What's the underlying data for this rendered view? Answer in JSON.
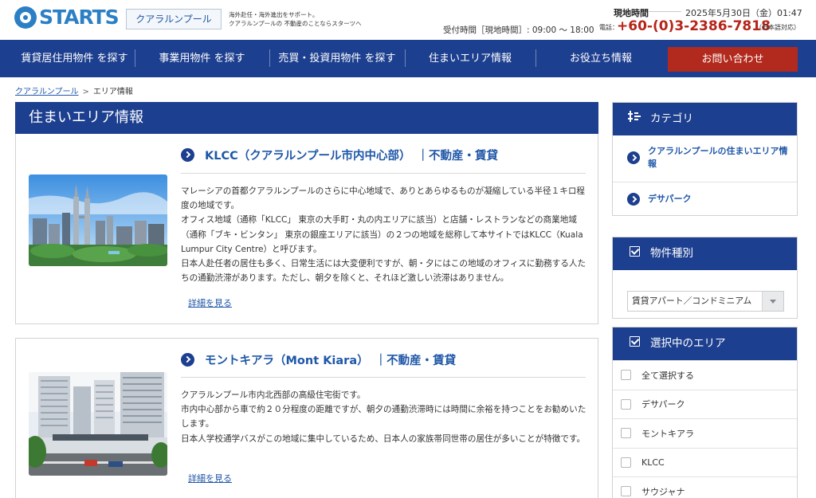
{
  "header": {
    "logo_text": "STARTS",
    "city_badge": "クアラルンプール",
    "tagline_1": "海外赴任・海外進出をサポート。",
    "tagline_2": "クアラルンプールの 不動産のことならスターツへ",
    "hours": "受付時間［現地時間］: 09:00 〜 18:00",
    "now_label": "現地時間",
    "now_value": "2025年5月30日（金）01:47",
    "phone_label": "電話：",
    "phone_number": "+60-(0)3-2386-7818",
    "phone_note": "（日本語対応）"
  },
  "nav": {
    "items": [
      "賃貸居住用物件 を探す",
      "事業用物件 を探す",
      "売買・投資用物件 を探す",
      "住まいエリア情報",
      "お役立ち情報"
    ],
    "cta": "お問い合わせ"
  },
  "breadcrumb": {
    "home": "クアラルンプール",
    "separator": ">",
    "current": "エリア情報"
  },
  "main": {
    "title": "住まいエリア情報",
    "cards": [
      {
        "title": "KLCC（クアラルンプール市内中心部）",
        "subtitle": "｜不動産・賃貸",
        "paragraphs": [
          "マレーシアの首都クアラルンプールのさらに中心地域で、ありとあらゆるものが凝縮している半径１キロ程度の地域です。",
          "オフィス地域（通称「KLCC」 東京の大手町・丸の内エリアに該当）と店舗・レストランなどの商業地域（通称「ブキ・ビンタン」 東京の銀座エリアに該当）の２つの地域を総称して本サイトではKLCC（Kuala Lumpur City Centre）と呼びます。",
          "日本人赴任者の居住も多く、日常生活には大変便利ですが、朝・夕にはこの地域のオフィスに勤務する人たちの通勤渋滞があります。ただし、朝夕を除くと、それほど激しい渋滞はありません。"
        ],
        "link": "詳細を見る"
      },
      {
        "title": "モントキアラ（Mont Kiara）",
        "subtitle": "｜不動産・賃貸",
        "paragraphs": [
          "クアラルンプール市内北西部の高級住宅街です。",
          "市内中心部から車で約２０分程度の距離ですが、朝夕の通勤渋滞時には時間に余裕を持つことをお勧めいたします。",
          "日本人学校通学バスがこの地域に集中しているため、日本人の家族帯同世帯の居住が多いことが特徴です。"
        ],
        "link": "詳細を見る"
      }
    ]
  },
  "sidebar": {
    "category": {
      "title": "カテゴリ",
      "items": [
        "クアラルンプールの住まいエリア情報",
        "デサパーク"
      ]
    },
    "property_type": {
      "title": "物件種別",
      "selected": "賃貸アパート／コンドミニアム"
    },
    "areas": {
      "title": "選択中のエリア",
      "items": [
        "全て選択する",
        "デサパーク",
        "モントキアラ",
        "KLCC",
        "サウジャナ"
      ]
    }
  },
  "colors": {
    "brand_blue": "#1d3f8f",
    "link_blue": "#1f57a8",
    "cta_red": "#b2291d",
    "phone_red": "#b52419",
    "logo_blue": "#2b7fc5"
  },
  "icons": [
    "logo-mark-icon",
    "chevron-circle-icon",
    "category-icon",
    "checkbox-icon",
    "select-arrow-icon"
  ]
}
